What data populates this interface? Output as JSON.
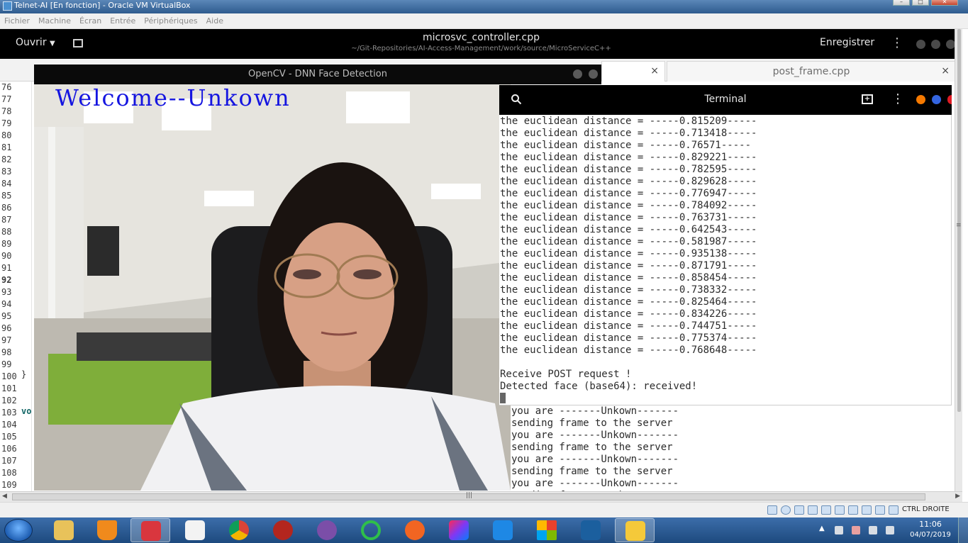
{
  "host_window": {
    "title": "Telnet-AI [En fonction] - Oracle VM VirtualBox",
    "menu": [
      "Fichier",
      "Machine",
      "Écran",
      "Entrée",
      "Périphériques",
      "Aide"
    ],
    "host_key_label": "CTRL DROITE"
  },
  "gedit": {
    "open_label": "Ouvrir",
    "file_title": "microsvc_controller.cpp",
    "file_path": "~/Git-Repositories/AI-Access-Management/work/source/MicroServiceC++",
    "save_label": "Enregistrer",
    "tabs": [
      {
        "label": "",
        "close": "×"
      },
      {
        "label": "post_frame.cpp",
        "close": "×"
      }
    ],
    "line_numbers": [
      "76",
      "77",
      "78",
      "79",
      "80",
      "81",
      "82",
      "83",
      "84",
      "85",
      "86",
      "87",
      "88",
      "89",
      "90",
      "91",
      "92",
      "93",
      "94",
      "95",
      "96",
      "97",
      "98",
      "99",
      "100",
      "101",
      "102",
      "103",
      "104",
      "105",
      "106",
      "107",
      "108",
      "109"
    ],
    "current_line": "92",
    "code_brace": "}",
    "code_fragment": "vo"
  },
  "opencv": {
    "title": "OpenCV - DNN Face Detection",
    "overlay_text": "Welcome--Unkown"
  },
  "terminal": {
    "title": "Terminal",
    "lines": [
      "the euclidean distance = -----0.815209-----",
      "the euclidean distance = -----0.713418-----",
      "the euclidean distance = -----0.76571-----",
      "the euclidean distance = -----0.829221-----",
      "the euclidean distance = -----0.782595-----",
      "the euclidean distance = -----0.829628-----",
      "the euclidean distance = -----0.776947-----",
      "the euclidean distance = -----0.784092-----",
      "the euclidean distance = -----0.763731-----",
      "the euclidean distance = -----0.642543-----",
      "the euclidean distance = -----0.581987-----",
      "the euclidean distance = -----0.935138-----",
      "the euclidean distance = -----0.871791-----",
      "the euclidean distance = -----0.858454-----",
      "the euclidean distance = -----0.738332-----",
      "the euclidean distance = -----0.825464-----",
      "the euclidean distance = -----0.834226-----",
      "the euclidean distance = -----0.744751-----",
      "the euclidean distance = -----0.775374-----",
      "the euclidean distance = -----0.768648-----",
      "",
      "Receive POST request !",
      "Detected face (base64): received!"
    ]
  },
  "client_log": {
    "lines": [
      "you are -------Unkown-------",
      "sending frame to the server",
      "you are -------Unkown-------",
      "sending frame to the server",
      "you are -------Unkown-------",
      "sending frame to the server",
      "you are -------Unkown-------",
      "sending frame to the server"
    ]
  },
  "taskbar": {
    "apps": [
      "explorer-icon",
      "vlc-icon",
      "snipping-tool-icon",
      "star-app-icon",
      "chrome-icon",
      "spider-app-icon",
      "github-desktop-icon",
      "refresh-app-icon",
      "pen-app-icon",
      "intellij-icon",
      "vscode-icon",
      "office-icon",
      "virtualbox-icon",
      "vm-window-icon"
    ],
    "clock_time": "11:06",
    "clock_date": "04/07/2019"
  },
  "colors": {
    "overlay_text": "#1515e0",
    "terminal_header": "#000000",
    "dot_orange": "#f57900",
    "dot_blue": "#3465e0",
    "dot_red": "#e01b24"
  }
}
